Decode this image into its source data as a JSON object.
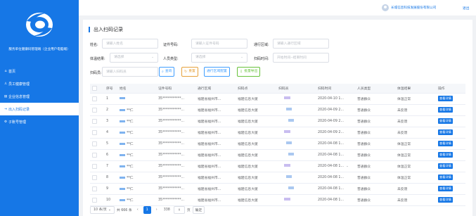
{
  "sidebar": {
    "system_title": "服务单位健康码管理端（企业用户电脑端）",
    "items": [
      {
        "icon": "⌂",
        "label": "首页",
        "active": false
      },
      {
        "icon": "♙",
        "label": "员工健康管理",
        "active": false
      },
      {
        "icon": "▤",
        "label": "企业信息管理",
        "active": false
      },
      {
        "icon": "⇥",
        "label": "出入扫码记录",
        "active": true
      },
      {
        "icon": "⚙",
        "label": "子账号管理",
        "active": false
      }
    ]
  },
  "header": {
    "company": "长城信息科技发展股份有限公司",
    "logout": "退出"
  },
  "page": {
    "title": "出入扫码记录"
  },
  "filters": {
    "name_label": "姓名:",
    "name_placeholder": "请输入姓名",
    "id_label": "证件号码:",
    "id_placeholder": "请输入证件号码",
    "area_label": "通行区域:",
    "area_placeholder": "请输入通行区域",
    "temp_label": "体温结果:",
    "temp_placeholder": "请选择",
    "type_label": "人员类型:",
    "type_placeholder": "请选择",
    "time_label": "扫码时间:",
    "time_placeholder": "开始时间--结束时间",
    "scanner_label": "扫码员:",
    "scanner_placeholder": "请输入扫码员"
  },
  "buttons": {
    "search": "查询",
    "reset": "重置",
    "area_config": "通行区域配置",
    "export": "批量导出"
  },
  "table": {
    "columns": [
      "序号",
      "姓名",
      "证件号码",
      "通行区域",
      "扫码点",
      "扫码员",
      "扫码时间",
      "人员类型",
      "体温结果",
      "操作"
    ],
    "rows": [
      {
        "no": "1",
        "name": "",
        "id": "35***********...",
        "area": "福建省福州市...",
        "point": "福建信息大厦",
        "time": "2020-04-10 1...",
        "type": "普通群众",
        "temp": "体温正常",
        "action": "查看详情"
      },
      {
        "no": "2",
        "name": "**仁",
        "id": "35***********...",
        "area": "福建省福州市...",
        "point": "福建信息大厦",
        "time": "2020-04-09 2...",
        "type": "普通群众",
        "temp": "未反馈",
        "action": "查看详情"
      },
      {
        "no": "3",
        "name": "**仁",
        "id": "35***********...",
        "area": "福建省福州市...",
        "point": "福建信息大厦",
        "time": "2020-04-09 2...",
        "type": "普通群众",
        "temp": "未反馈",
        "action": "查看详情"
      },
      {
        "no": "4",
        "name": "**仁",
        "id": "35***********...",
        "area": "福建省福州市...",
        "point": "福建信息大厦",
        "time": "2020-04-09 2...",
        "type": "普通群众",
        "temp": "未反馈",
        "action": "查看详情"
      },
      {
        "no": "5",
        "name": "**仁",
        "id": "35***********...",
        "area": "福建省福州市...",
        "point": "福建信息大厦",
        "time": "2020-04-08 1...",
        "type": "普通群众",
        "temp": "体温正常",
        "action": "查看详情"
      },
      {
        "no": "6",
        "name": "**仁",
        "id": "35***********...",
        "area": "福建省福州市...",
        "point": "福建信息大厦",
        "time": "2020-04-08 1...",
        "type": "普通群众",
        "temp": "体温正常",
        "action": "查看详情"
      },
      {
        "no": "7",
        "name": "**仁",
        "id": "35***********...",
        "area": "福建省福州市...",
        "point": "福建信息大厦",
        "time": "2020-04-08 1...",
        "type": "普通群众",
        "temp": "体温正常",
        "action": "查看详情"
      },
      {
        "no": "8",
        "name": "**仁",
        "id": "35***********...",
        "area": "福建省福州市...",
        "point": "福建信息大厦",
        "time": "2020-04-08 1...",
        "type": "普通群众",
        "temp": "体温正常",
        "action": "查看详情"
      },
      {
        "no": "9",
        "name": "**仁",
        "id": "35***********...",
        "area": "福建省福州市...",
        "point": "福建信息大厦",
        "time": "2020-04-08 1...",
        "type": "普通群众",
        "temp": "未反馈",
        "action": "查看详情"
      },
      {
        "no": "10",
        "name": "**仁",
        "id": "35***********...",
        "area": "福建省福州市...",
        "point": "福建信息大厦",
        "time": "2020-04-08 1...",
        "type": "普通群众",
        "temp": "未反馈",
        "action": "查看详情"
      }
    ]
  },
  "pagination": {
    "page_size": "10 条/页",
    "total": "共 666 条",
    "current": "1",
    "last": "338",
    "jump_value": "1",
    "jump_suffix": "页",
    "confirm": "确定"
  }
}
